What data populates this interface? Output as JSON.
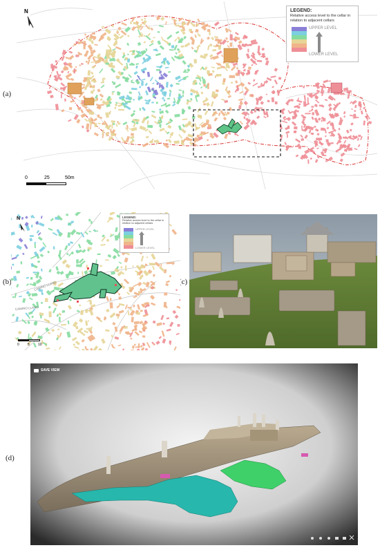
{
  "figure": {
    "labels": {
      "a": "(a)",
      "b": "(b)",
      "c": "(c)",
      "d": "(d)"
    },
    "north": "N",
    "legend_a": {
      "title": "LEGEND:",
      "subtitle": "Relative access level to the cellar in relation to adjacent cellars",
      "upper": "UPPER LEVEL",
      "lower": "LOWER LEVEL",
      "colors": [
        "#8a7fd6",
        "#7ccfe0",
        "#86dca0",
        "#e6d597",
        "#f0b48a",
        "#ee8e96"
      ]
    },
    "legend_b": {
      "title": "LEGEND:",
      "subtitle": "Relative access level to the cellar in relation to adjacent cellars",
      "upper": "UPPER LEVEL",
      "lower": "LOWER LEVEL"
    },
    "scale_a": {
      "ticks": [
        "0",
        "25",
        "50m"
      ]
    },
    "scale_b": {
      "ticks": [
        "0",
        "5",
        "10"
      ]
    },
    "street_b": {
      "name1": "CAMINO LLANO",
      "name2": "CAMINO LLANO"
    },
    "viewer": {
      "save_view": "SAVE VIEW"
    }
  }
}
